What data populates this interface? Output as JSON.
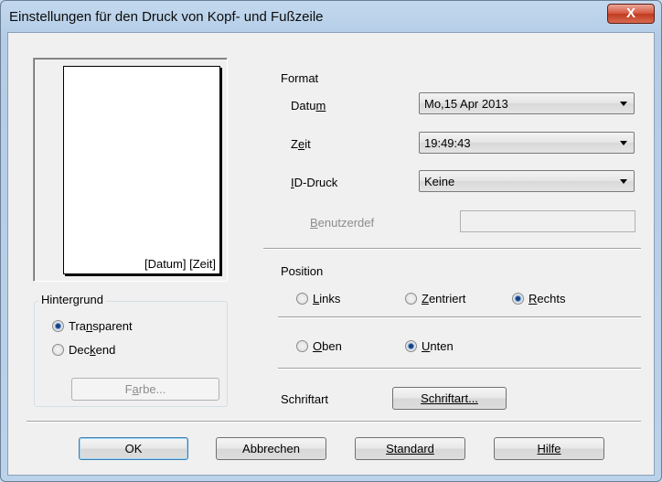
{
  "window": {
    "title": "Einstellungen für den Druck von Kopf- und Fußzeile",
    "close_glyph": "X"
  },
  "preview": {
    "text": "[Datum] [Zeit]"
  },
  "background": {
    "group_label": "Hintergrund",
    "transparent": {
      "pre": "Tra",
      "u": "n",
      "post": "sparent",
      "checked": true
    },
    "opaque": {
      "pre": "Dec",
      "u": "k",
      "post": "end",
      "checked": false
    },
    "color_button": {
      "pre": "F",
      "u": "a",
      "post": "rbe..."
    }
  },
  "format": {
    "heading": "Format",
    "date": {
      "label_pre": "Datu",
      "label_u": "m",
      "value": "Mo,15 Apr 2013"
    },
    "time": {
      "label_pre": "Z",
      "label_u": "e",
      "label_post": "it",
      "value": "19:49:43"
    },
    "id_print": {
      "label_u": "I",
      "label_post": "D-Druck",
      "value": "Keine"
    },
    "custom": {
      "label_u": "B",
      "label_post": "enutzerdef",
      "value": ""
    }
  },
  "position": {
    "heading": "Position",
    "left": {
      "u": "L",
      "post": "inks",
      "checked": false
    },
    "center": {
      "u": "Z",
      "post": "entriert",
      "checked": false
    },
    "right": {
      "u": "R",
      "post": "echts",
      "checked": true
    },
    "top": {
      "u": "O",
      "post": "ben",
      "checked": false
    },
    "bottom": {
      "u": "U",
      "post": "nten",
      "checked": true
    }
  },
  "font": {
    "label": "Schriftart",
    "button": {
      "pre": "Sc",
      "u": "h",
      "post": "riftart..."
    }
  },
  "buttons": {
    "ok": "OK",
    "cancel": "Abbrechen",
    "standard": {
      "u": "S",
      "post": "tandard"
    },
    "help": {
      "u": "H",
      "post": "ilfe"
    }
  },
  "colors": {
    "accent": "#1a3f7a",
    "close": "#c0391f"
  }
}
